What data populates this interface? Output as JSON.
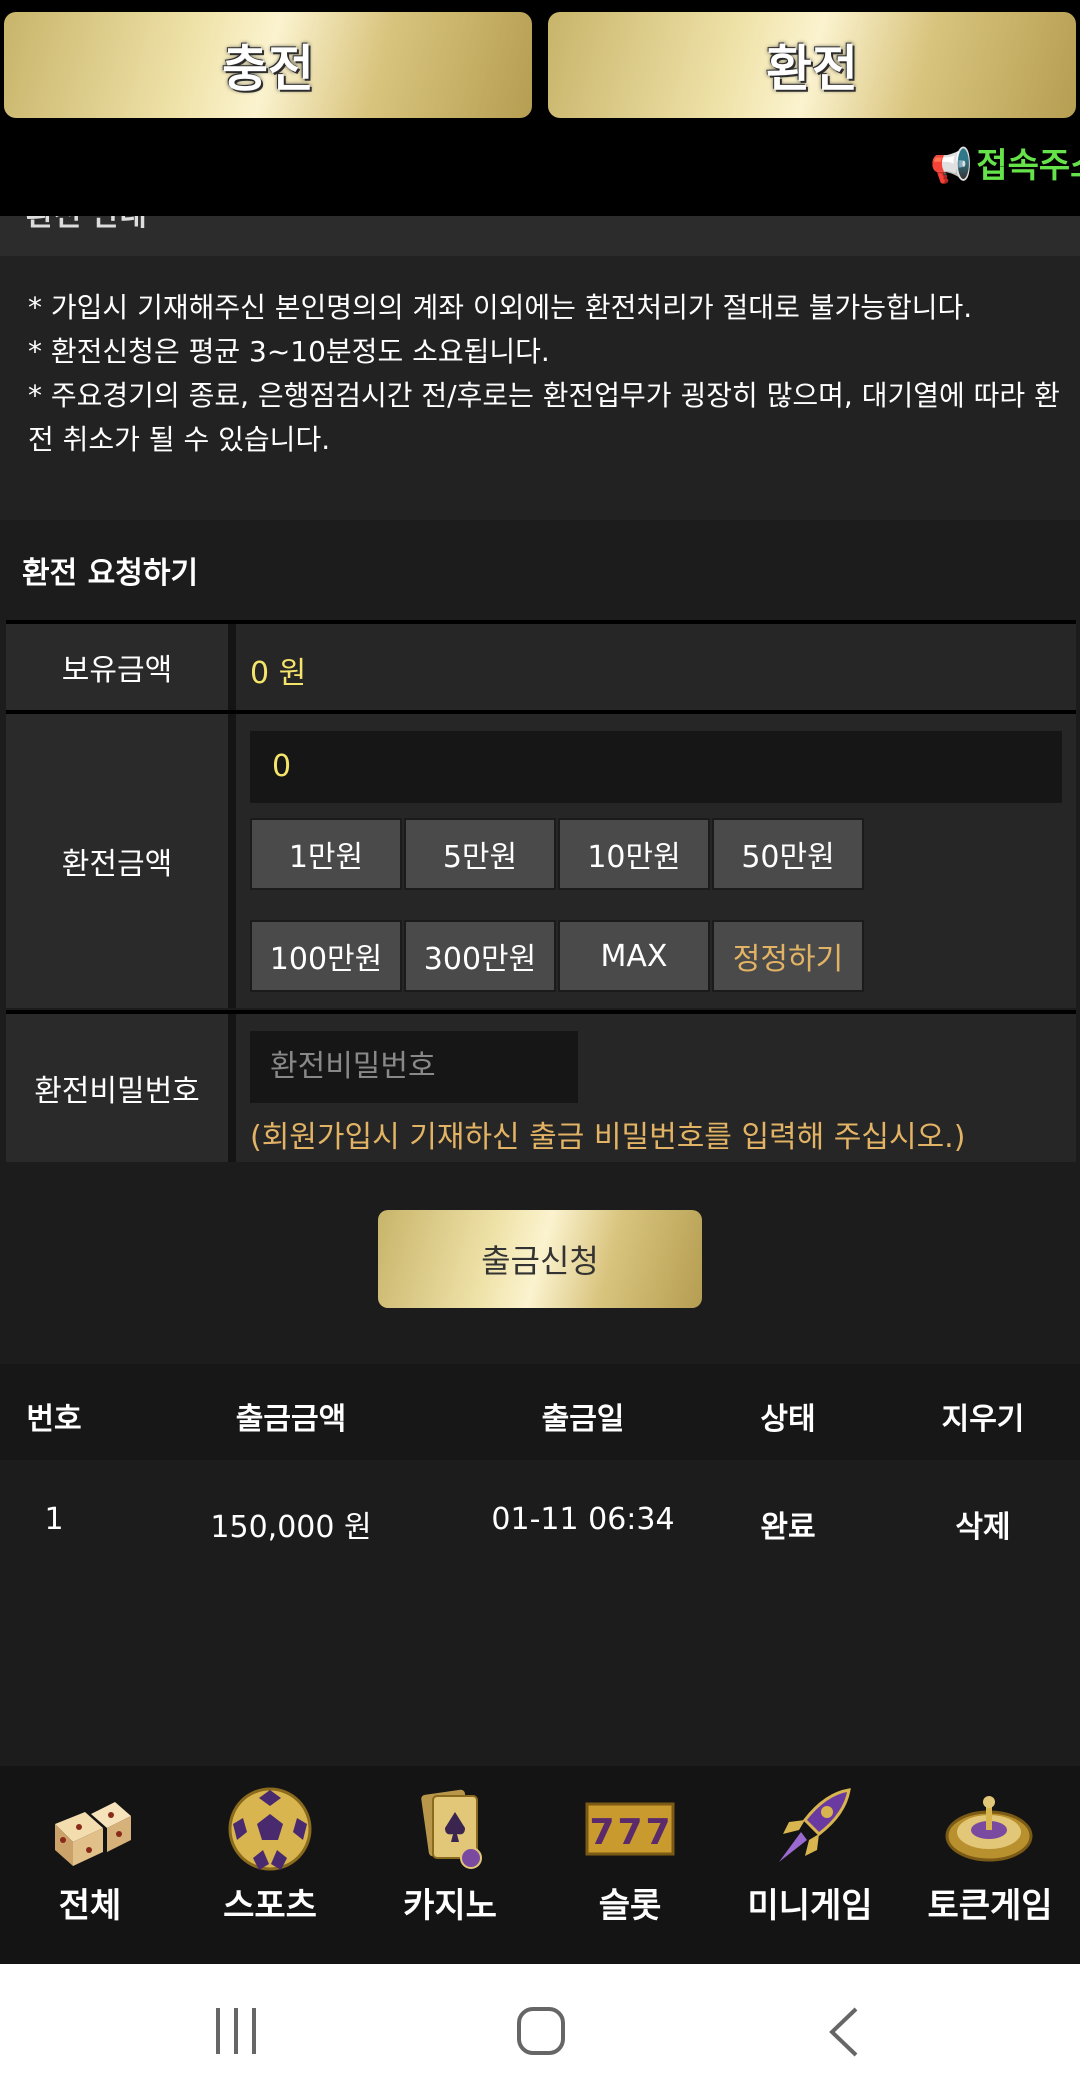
{
  "top_buttons": {
    "charge": "충전",
    "exchange": "환전"
  },
  "marquee": {
    "icon": "megaphone-icon",
    "text": "접속주소"
  },
  "notice": {
    "lines": [
      "* 가입시 기재해주신 본인명의의 계좌 이외에는 환전처리가 절대로 불가능합니다.",
      "* 환전신청은 평균 3~10분정도 소요됩니다.",
      "* 주요경기의 종료, 은행점검시간 전/후로는 환전업무가 굉장히 많으며, 대기열에 따라 환전 취소가 될 수 있습니다."
    ]
  },
  "request": {
    "title": "환전 요청하기",
    "hold_label": "보유금액",
    "hold_value": "0 원",
    "amount_label": "환전금액",
    "amount_value": "0",
    "amount_buttons": [
      "1만원",
      "5만원",
      "10만원",
      "50만원",
      "100만원",
      "300만원",
      "MAX",
      "정정하기"
    ],
    "password_label": "환전비밀번호",
    "password_placeholder": "환전비밀번호",
    "password_hint": "(회원가입시 기재하신 출금 비밀번호를 입력해 주십시오.)",
    "submit_label": "출금신청"
  },
  "history": {
    "headers": [
      "번호",
      "출금금액",
      "출금일",
      "상태",
      "지우기"
    ],
    "rows": [
      {
        "no": "1",
        "amount": "150,000 원",
        "date": "01-11 06:34",
        "status": "완료",
        "action": "삭제"
      }
    ]
  },
  "bottom_nav": [
    {
      "label": "전체",
      "icon": "dice-icon"
    },
    {
      "label": "스포츠",
      "icon": "soccer-ball-icon"
    },
    {
      "label": "카지노",
      "icon": "playing-cards-icon"
    },
    {
      "label": "슬롯",
      "icon": "slot-777-icon"
    },
    {
      "label": "미니게임",
      "icon": "rocket-icon"
    },
    {
      "label": "토큰게임",
      "icon": "roulette-icon"
    }
  ],
  "colors": {
    "gold": "#e8d89a",
    "accent_yellow": "#f5e46a",
    "accent_orange": "#e2b364",
    "marquee_green": "#66e24a"
  }
}
